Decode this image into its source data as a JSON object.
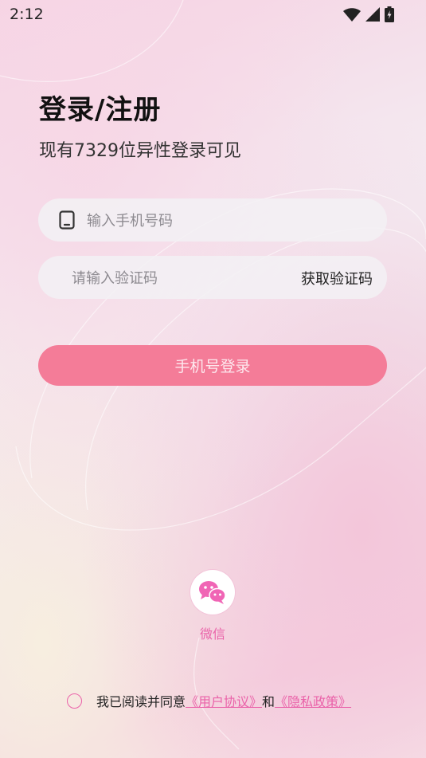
{
  "status_bar": {
    "time": "2:12",
    "icons": [
      "wifi-icon",
      "signal-icon",
      "battery-charging-icon"
    ]
  },
  "header": {
    "title": "登录/注册",
    "subtitle": "现有7329位异性登录可见"
  },
  "form": {
    "phone_placeholder": "输入手机号码",
    "phone_icon": "phone-icon",
    "code_placeholder": "请输入验证码",
    "get_code_label": "获取验证码",
    "login_button_label": "手机号登录"
  },
  "social": {
    "wechat_label": "微信",
    "wechat_icon": "wechat-icon"
  },
  "agreement": {
    "prefix": "我已阅读并同意",
    "user_agreement": "《用户协议》",
    "and": "和",
    "privacy_policy": "《隐私政策》",
    "checked": false
  },
  "colors": {
    "accent": "#F47C98",
    "link": "#EA62A9",
    "wechat": "#F065B5"
  }
}
